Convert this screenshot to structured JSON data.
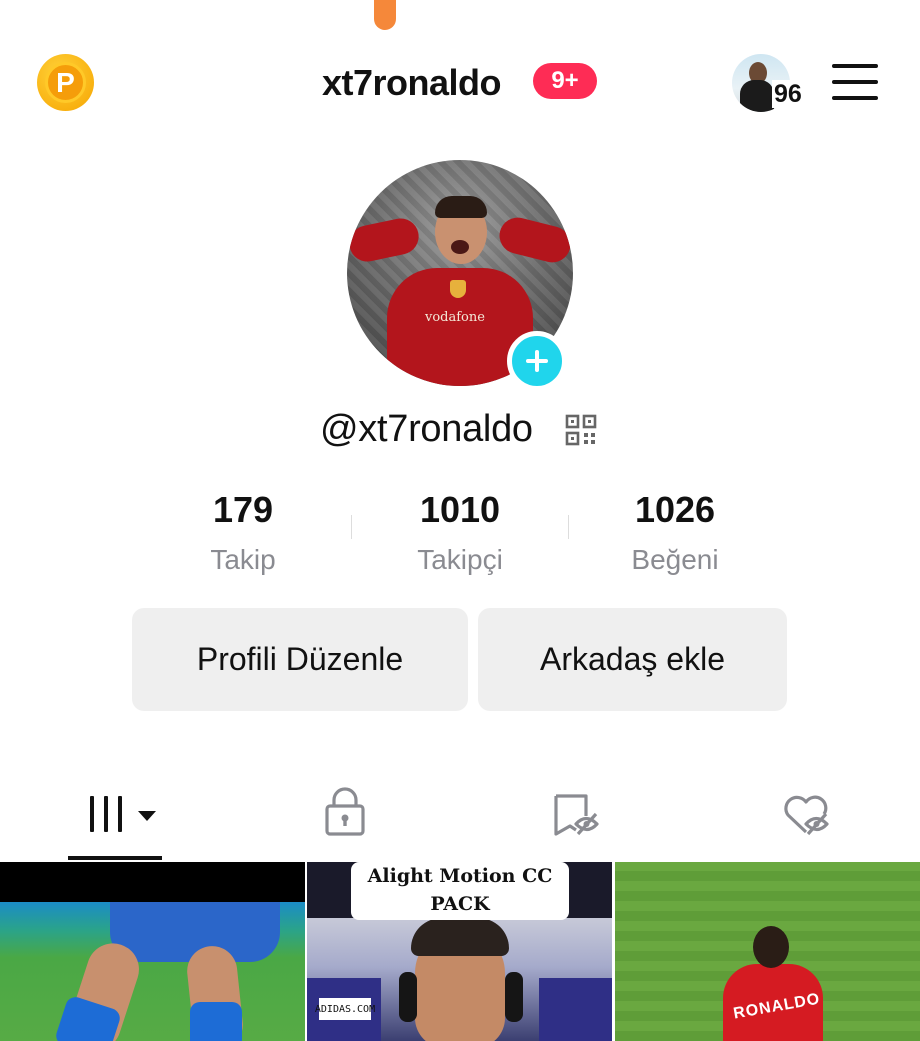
{
  "header": {
    "username": "xt7ronaldo",
    "notification_badge": "9+",
    "friends_count": "96"
  },
  "profile": {
    "handle": "@xt7ronaldo"
  },
  "stats": [
    {
      "value": "179",
      "label": "Takip"
    },
    {
      "value": "1010",
      "label": "Takipçi"
    },
    {
      "value": "1026",
      "label": "Beğeni"
    }
  ],
  "actions": {
    "edit_profile": "Profili Düzenle",
    "add_friend": "Arkadaş ekle"
  },
  "tabs": [
    {
      "icon": "videos-grid-icon",
      "active": true
    },
    {
      "icon": "lock-icon",
      "active": false
    },
    {
      "icon": "saved-hidden-icon",
      "active": false
    },
    {
      "icon": "liked-hidden-icon",
      "active": false
    }
  ],
  "videos": [
    {
      "caption": ""
    },
    {
      "caption": "Alight Motion CC PACK",
      "sponsor": "ADIDAS.COM"
    },
    {
      "caption": "",
      "jersey_name": "RONALDO"
    }
  ],
  "colors": {
    "accent_red": "#fe2c55",
    "add_button_cyan": "#20d5ec",
    "coin_gold": "#f6a400",
    "button_gray": "#efefef",
    "muted_text": "#8a8b91"
  }
}
